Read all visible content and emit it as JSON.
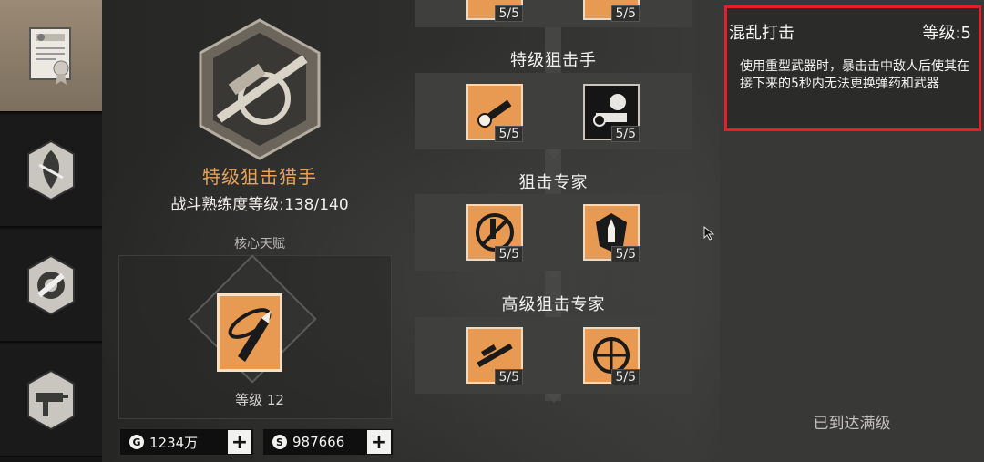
{
  "sidebar": {
    "tabs": [
      {
        "icon": "certificate-icon",
        "active": true
      },
      {
        "icon": "leaf-badge-icon",
        "active": false
      },
      {
        "icon": "gear-wrench-icon",
        "active": false
      },
      {
        "icon": "submachine-gun-icon",
        "active": false
      }
    ]
  },
  "class_info": {
    "name": "特级狙击猎手",
    "mastery": "战斗熟练度等级:138/140",
    "core_label": "核心天赋",
    "core_level": "等级 12"
  },
  "currency": {
    "gold": "1234万",
    "silver": "987666",
    "gold_symbol": "G",
    "silver_symbol": "S",
    "plus": "+"
  },
  "tree": {
    "top_ranks": [
      "5/5",
      "5/5"
    ],
    "tiers": [
      {
        "title": "特级狙击手",
        "nodes": [
          {
            "icon": "scope-rifle-icon",
            "rank": "5/5"
          },
          {
            "icon": "soldier-aim-icon",
            "rank": "5/5"
          }
        ]
      },
      {
        "title": "狙击专家",
        "nodes": [
          {
            "icon": "no-ammo-icon",
            "rank": "5/5"
          },
          {
            "icon": "bullet-shield-icon",
            "rank": "5/5"
          }
        ]
      },
      {
        "title": "高级狙击专家",
        "nodes": [
          {
            "icon": "sniper-rifle-icon",
            "rank": "5/5"
          },
          {
            "icon": "crosshair-icon",
            "rank": "5/5"
          }
        ]
      }
    ]
  },
  "detail": {
    "skill_name": "混乱打击",
    "skill_level": "等级:5",
    "description": "使用重型武器时，暴击击中敌人后使其在接下来的5秒内无法更换弹药和武器",
    "maxed": "已到达满级"
  },
  "colors": {
    "accent": "#e89a52",
    "highlight_border": "#e0202a"
  }
}
